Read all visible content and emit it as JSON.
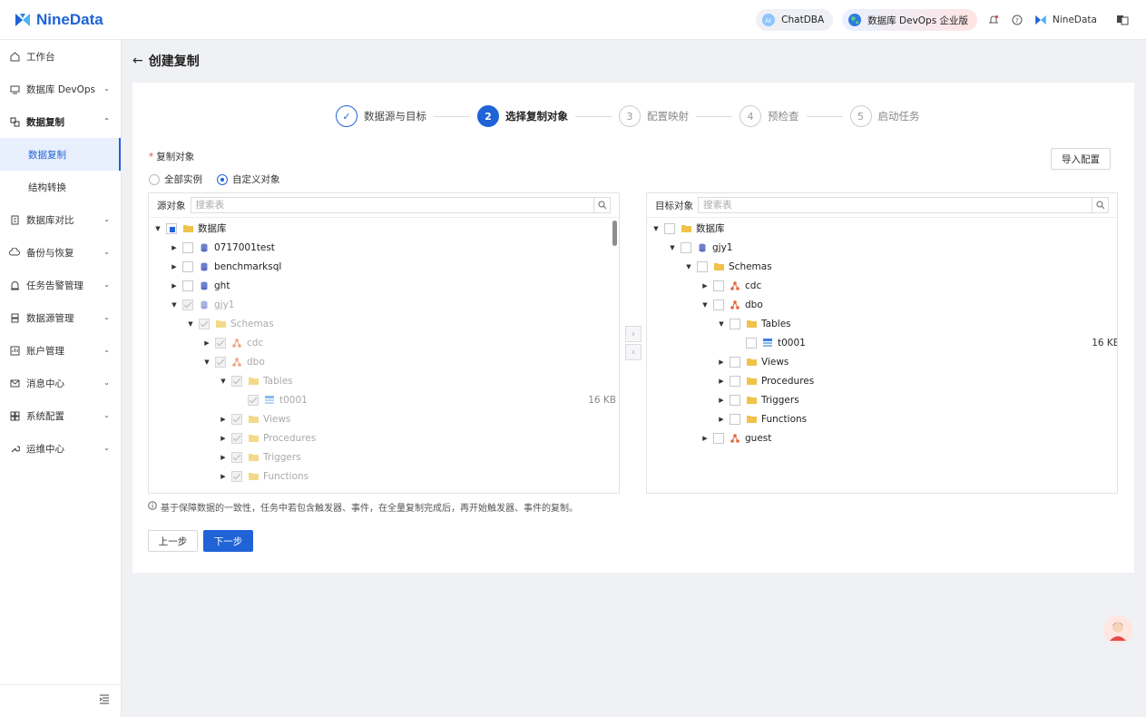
{
  "header": {
    "brand": "NineData",
    "chatdba_label": "ChatDBA",
    "devops_label": "数据库 DevOps 企业版",
    "user_label": "NineData"
  },
  "sidebar": {
    "items": [
      {
        "label": "工作台"
      },
      {
        "label": "数据库 DevOps"
      },
      {
        "label": "数据复制"
      },
      {
        "label": "数据复制"
      },
      {
        "label": "结构转换"
      },
      {
        "label": "数据库对比"
      },
      {
        "label": "备份与恢复"
      },
      {
        "label": "任务告警管理"
      },
      {
        "label": "数据源管理"
      },
      {
        "label": "账户管理"
      },
      {
        "label": "消息中心"
      },
      {
        "label": "系统配置"
      },
      {
        "label": "运维中心"
      }
    ]
  },
  "page": {
    "title": "创建复制"
  },
  "steps": [
    {
      "num": "✓",
      "label": "数据源与目标"
    },
    {
      "num": "2",
      "label": "选择复制对象"
    },
    {
      "num": "3",
      "label": "配置映射"
    },
    {
      "num": "4",
      "label": "预检查"
    },
    {
      "num": "5",
      "label": "启动任务"
    }
  ],
  "form": {
    "required_mark": "*",
    "field_label": "复制对象",
    "radio_all": "全部实例",
    "radio_custom": "自定义对象",
    "import_button": "导入配置"
  },
  "source_panel": {
    "title": "源对象",
    "search_placeholder": "搜索表",
    "rows": [
      {
        "label": "数据库"
      },
      {
        "label": "0717001test"
      },
      {
        "label": "benchmarksql"
      },
      {
        "label": "ght"
      },
      {
        "label": "gjy1"
      },
      {
        "label": "Schemas"
      },
      {
        "label": "cdc"
      },
      {
        "label": "dbo"
      },
      {
        "label": "Tables"
      },
      {
        "label": "t0001",
        "size": "16 KB"
      },
      {
        "label": "Views"
      },
      {
        "label": "Procedures"
      },
      {
        "label": "Triggers"
      },
      {
        "label": "Functions"
      }
    ]
  },
  "target_panel": {
    "title": "目标对象",
    "search_placeholder": "搜索表",
    "rows": [
      {
        "label": "数据库"
      },
      {
        "label": "gjy1"
      },
      {
        "label": "Schemas"
      },
      {
        "label": "cdc"
      },
      {
        "label": "dbo"
      },
      {
        "label": "Tables"
      },
      {
        "label": "t0001",
        "size": "16 KB"
      },
      {
        "label": "Views"
      },
      {
        "label": "Procedures"
      },
      {
        "label": "Triggers"
      },
      {
        "label": "Functions"
      },
      {
        "label": "guest"
      }
    ]
  },
  "note": "基于保障数据的一致性，任务中若包含触发器、事件，在全量复制完成后，再开始触发器、事件的复制。",
  "buttons": {
    "prev": "上一步",
    "next": "下一步"
  },
  "colors": {
    "primary": "#1f63d6",
    "folder": "#f0c24a",
    "schema": "#e8643c"
  }
}
